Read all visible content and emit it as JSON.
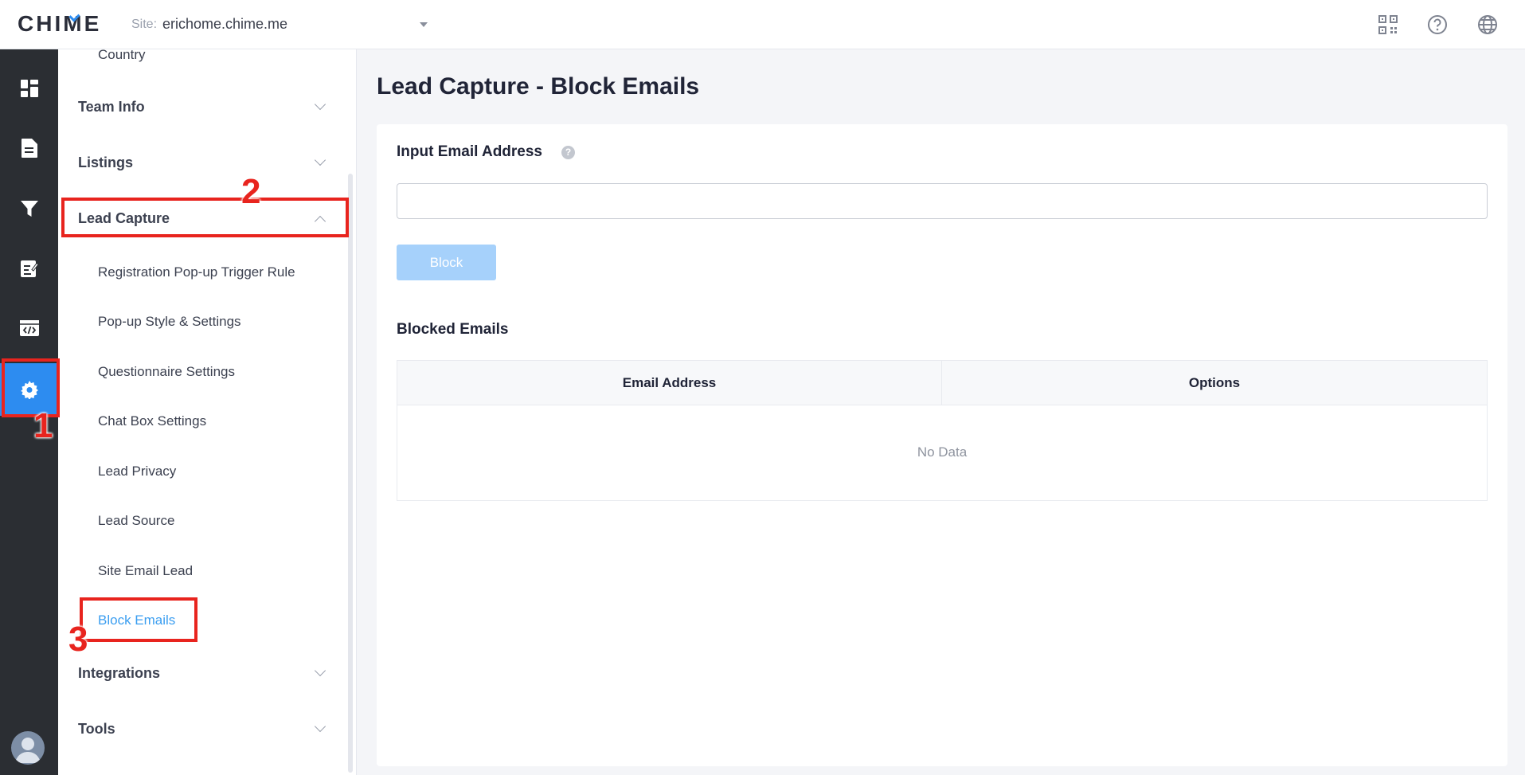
{
  "header": {
    "logo": "CHIME",
    "site_label": "Site:",
    "site_value": "erichome.chime.me",
    "icons": [
      "qr-code-icon",
      "help-circle-icon",
      "globe-icon"
    ]
  },
  "rail": {
    "items": [
      "dashboard-icon",
      "document-icon",
      "filter-icon",
      "edit-list-icon",
      "code-icon",
      "settings-icon"
    ],
    "active": "settings-icon"
  },
  "submenu": {
    "country": "Country",
    "team_info": "Team Info",
    "listings": "Listings",
    "lead_capture": "Lead Capture",
    "items": [
      "Registration Pop-up Trigger Rule",
      "Pop-up Style & Settings",
      "Questionnaire Settings",
      "Chat Box Settings",
      "Lead Privacy",
      "Lead Source",
      "Site Email Lead",
      "Block Emails"
    ],
    "active_item": "Block Emails",
    "integrations": "Integrations",
    "tools": "Tools"
  },
  "main": {
    "title": "Lead Capture - Block Emails",
    "input_label": "Input Email Address",
    "input_value": "",
    "block_button": "Block",
    "blocked_title": "Blocked Emails",
    "table": {
      "columns": [
        "Email Address",
        "Options"
      ],
      "empty_text": "No Data"
    }
  },
  "annotations": [
    "1",
    "2",
    "3"
  ],
  "colors": {
    "accent": "#2d8cf0",
    "rail_bg": "#2b2e33",
    "annotation": "#e8241e",
    "active_link": "#3b9ef0"
  }
}
